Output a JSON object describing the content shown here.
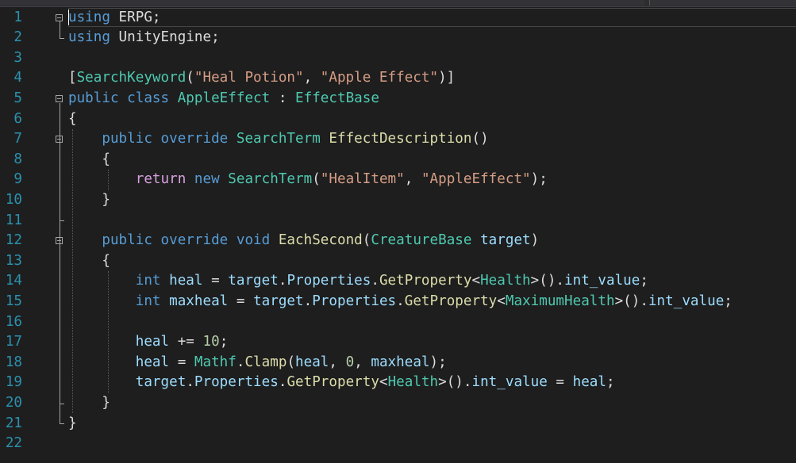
{
  "editor": {
    "lines": [
      {
        "n": "1",
        "t": [
          [
            "kw",
            "using"
          ],
          [
            "p",
            " ERPG;"
          ]
        ]
      },
      {
        "n": "2",
        "t": [
          [
            "kw",
            "using"
          ],
          [
            "p",
            " UnityEngine;"
          ]
        ]
      },
      {
        "n": "3",
        "t": []
      },
      {
        "n": "4",
        "t": [
          [
            "p",
            "["
          ],
          [
            "type",
            "SearchKeyword"
          ],
          [
            "p",
            "("
          ],
          [
            "str",
            "\"Heal Potion\""
          ],
          [
            "p",
            ", "
          ],
          [
            "str",
            "\"Apple Effect\""
          ],
          [
            "p",
            ")]"
          ]
        ]
      },
      {
        "n": "5",
        "t": [
          [
            "kw",
            "public"
          ],
          [
            "p",
            " "
          ],
          [
            "kw",
            "class"
          ],
          [
            "p",
            " "
          ],
          [
            "type",
            "AppleEffect"
          ],
          [
            "p",
            " : "
          ],
          [
            "type",
            "EffectBase"
          ]
        ]
      },
      {
        "n": "6",
        "t": [
          [
            "p",
            "{"
          ]
        ]
      },
      {
        "n": "7",
        "t": [
          [
            "p",
            "    "
          ],
          [
            "kw",
            "public"
          ],
          [
            "p",
            " "
          ],
          [
            "kw",
            "override"
          ],
          [
            "p",
            " "
          ],
          [
            "type",
            "SearchTerm"
          ],
          [
            "p",
            " "
          ],
          [
            "fn",
            "EffectDescription"
          ],
          [
            "p",
            "()"
          ]
        ]
      },
      {
        "n": "8",
        "t": [
          [
            "p",
            "    {"
          ]
        ]
      },
      {
        "n": "9",
        "t": [
          [
            "p",
            "        "
          ],
          [
            "kw2",
            "return"
          ],
          [
            "p",
            " "
          ],
          [
            "kw",
            "new"
          ],
          [
            "p",
            " "
          ],
          [
            "type",
            "SearchTerm"
          ],
          [
            "p",
            "("
          ],
          [
            "str",
            "\"HealItem\""
          ],
          [
            "p",
            ", "
          ],
          [
            "str",
            "\"AppleEffect\""
          ],
          [
            "p",
            ");"
          ]
        ]
      },
      {
        "n": "10",
        "t": [
          [
            "p",
            "    }"
          ]
        ]
      },
      {
        "n": "11",
        "t": []
      },
      {
        "n": "12",
        "t": [
          [
            "p",
            "    "
          ],
          [
            "kw",
            "public"
          ],
          [
            "p",
            " "
          ],
          [
            "kw",
            "override"
          ],
          [
            "p",
            " "
          ],
          [
            "kw",
            "void"
          ],
          [
            "p",
            " "
          ],
          [
            "fn",
            "EachSecond"
          ],
          [
            "p",
            "("
          ],
          [
            "type",
            "CreatureBase"
          ],
          [
            "p",
            " "
          ],
          [
            "var",
            "target"
          ],
          [
            "p",
            ")"
          ]
        ]
      },
      {
        "n": "13",
        "t": [
          [
            "p",
            "    {"
          ]
        ]
      },
      {
        "n": "14",
        "t": [
          [
            "p",
            "        "
          ],
          [
            "kw",
            "int"
          ],
          [
            "p",
            " "
          ],
          [
            "var",
            "heal"
          ],
          [
            "p",
            " = "
          ],
          [
            "var",
            "target"
          ],
          [
            "p",
            "."
          ],
          [
            "var",
            "Properties"
          ],
          [
            "p",
            "."
          ],
          [
            "fn",
            "GetProperty"
          ],
          [
            "p",
            "<"
          ],
          [
            "type",
            "Health"
          ],
          [
            "p",
            ">()."
          ],
          [
            "var",
            "int_value"
          ],
          [
            "p",
            ";"
          ]
        ]
      },
      {
        "n": "15",
        "t": [
          [
            "p",
            "        "
          ],
          [
            "kw",
            "int"
          ],
          [
            "p",
            " "
          ],
          [
            "var",
            "maxheal"
          ],
          [
            "p",
            " = "
          ],
          [
            "var",
            "target"
          ],
          [
            "p",
            "."
          ],
          [
            "var",
            "Properties"
          ],
          [
            "p",
            "."
          ],
          [
            "fn",
            "GetProperty"
          ],
          [
            "p",
            "<"
          ],
          [
            "type",
            "MaximumHealth"
          ],
          [
            "p",
            ">()."
          ],
          [
            "var",
            "int_value"
          ],
          [
            "p",
            ";"
          ]
        ]
      },
      {
        "n": "16",
        "t": []
      },
      {
        "n": "17",
        "t": [
          [
            "p",
            "        "
          ],
          [
            "var",
            "heal"
          ],
          [
            "p",
            " += "
          ],
          [
            "num",
            "10"
          ],
          [
            "p",
            ";"
          ]
        ]
      },
      {
        "n": "18",
        "t": [
          [
            "p",
            "        "
          ],
          [
            "var",
            "heal"
          ],
          [
            "p",
            " = "
          ],
          [
            "type",
            "Mathf"
          ],
          [
            "p",
            "."
          ],
          [
            "fn",
            "Clamp"
          ],
          [
            "p",
            "("
          ],
          [
            "var",
            "heal"
          ],
          [
            "p",
            ", "
          ],
          [
            "num",
            "0"
          ],
          [
            "p",
            ", "
          ],
          [
            "var",
            "maxheal"
          ],
          [
            "p",
            ");"
          ]
        ]
      },
      {
        "n": "19",
        "t": [
          [
            "p",
            "        "
          ],
          [
            "var",
            "target"
          ],
          [
            "p",
            "."
          ],
          [
            "var",
            "Properties"
          ],
          [
            "p",
            "."
          ],
          [
            "fn",
            "GetProperty"
          ],
          [
            "p",
            "<"
          ],
          [
            "type",
            "Health"
          ],
          [
            "p",
            ">()."
          ],
          [
            "var",
            "int_value"
          ],
          [
            "p",
            " = "
          ],
          [
            "var",
            "heal"
          ],
          [
            "p",
            ";"
          ]
        ]
      },
      {
        "n": "20",
        "t": [
          [
            "p",
            "    }"
          ]
        ]
      },
      {
        "n": "21",
        "t": [
          [
            "p",
            "}"
          ]
        ]
      },
      {
        "n": "22",
        "t": []
      }
    ]
  }
}
